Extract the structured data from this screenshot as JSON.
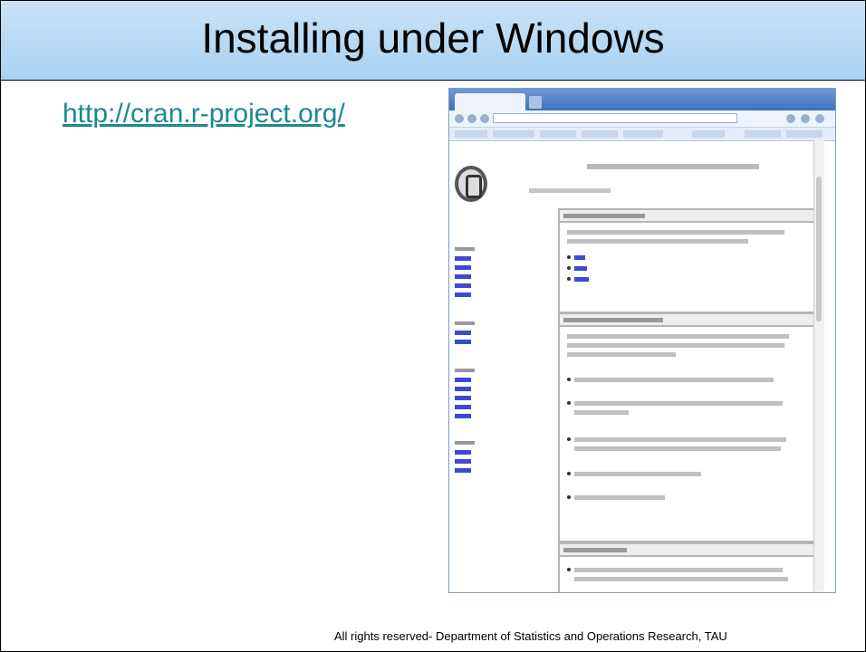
{
  "slide": {
    "title": "Installing under Windows",
    "link_text": "http://cran.r-project.org/",
    "footer": "All rights reserved- Department of  Statistics and Operations Research, TAU"
  },
  "colors": {
    "title_bar": "#b6d9f5",
    "link": "#1a8a8f",
    "browser_chrome": "#3f6fbf"
  },
  "screenshot": {
    "description_icon": "browser-window-icon"
  }
}
